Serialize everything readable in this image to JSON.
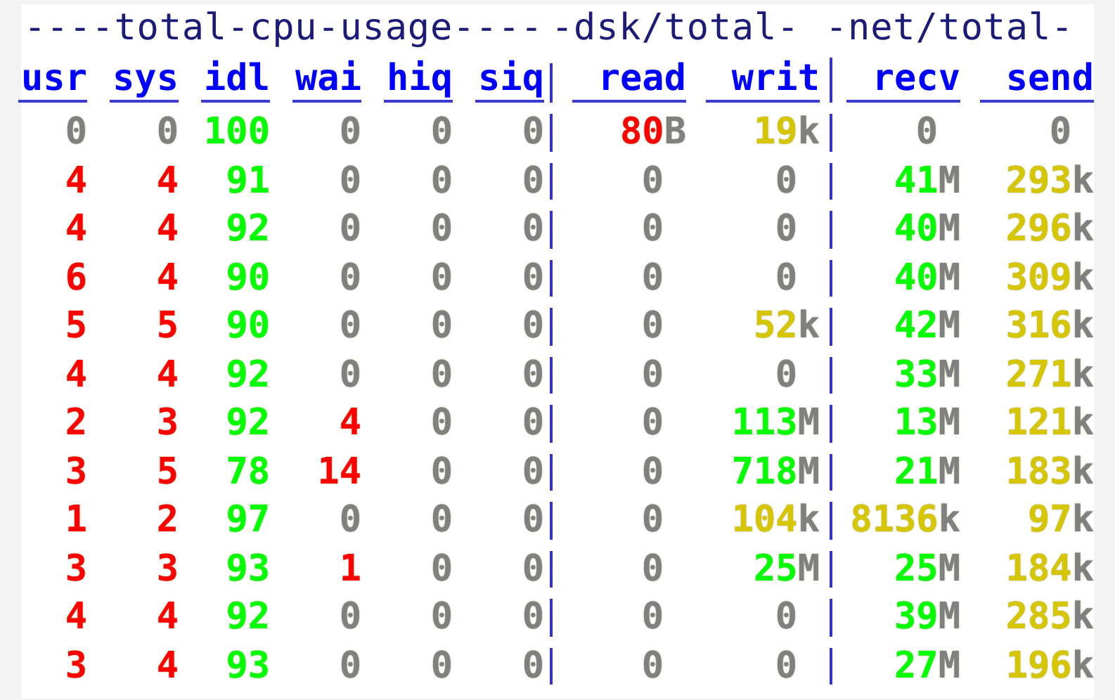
{
  "sections": [
    {
      "title": "----total-cpu-usage----",
      "kind": "cpu"
    },
    {
      "title": "-dsk/total-",
      "kind": "dsk"
    },
    {
      "title": "-net/total-",
      "kind": "net"
    }
  ],
  "columns": [
    {
      "label": "usr",
      "kind": "cpu"
    },
    {
      "label": "sys",
      "kind": "cpu"
    },
    {
      "label": "idl",
      "kind": "cpu"
    },
    {
      "label": "wai",
      "kind": "cpu"
    },
    {
      "label": "hiq",
      "kind": "cpu"
    },
    {
      "label": "siq",
      "kind": "cpu"
    },
    {
      "label": "read",
      "kind": "io"
    },
    {
      "label": "writ",
      "kind": "io"
    },
    {
      "label": "recv",
      "kind": "io"
    },
    {
      "label": "send",
      "kind": "io"
    }
  ],
  "rows": [
    {
      "cells": [
        {
          "value": "0",
          "color": "#808080"
        },
        {
          "value": "0",
          "color": "#808080"
        },
        {
          "value": "100",
          "color": "#00ff00"
        },
        {
          "value": "0",
          "color": "#808080"
        },
        {
          "value": "0",
          "color": "#808080"
        },
        {
          "value": "0",
          "color": "#808080"
        },
        {
          "value": "80",
          "unit": "B",
          "color": "#ff0000"
        },
        {
          "value": "19",
          "unit": "k",
          "color": "#d6c600"
        },
        {
          "value": "0",
          "color": "#808080"
        },
        {
          "value": "0",
          "color": "#808080"
        }
      ]
    },
    {
      "cells": [
        {
          "value": "4",
          "color": "#ff0000"
        },
        {
          "value": "4",
          "color": "#ff0000"
        },
        {
          "value": "91",
          "color": "#00ff00"
        },
        {
          "value": "0",
          "color": "#808080"
        },
        {
          "value": "0",
          "color": "#808080"
        },
        {
          "value": "0",
          "color": "#808080"
        },
        {
          "value": "0",
          "color": "#808080"
        },
        {
          "value": "0",
          "color": "#808080"
        },
        {
          "value": "41",
          "unit": "M",
          "color": "#00ff00"
        },
        {
          "value": "293",
          "unit": "k",
          "color": "#d6c600"
        }
      ]
    },
    {
      "cells": [
        {
          "value": "4",
          "color": "#ff0000"
        },
        {
          "value": "4",
          "color": "#ff0000"
        },
        {
          "value": "92",
          "color": "#00ff00"
        },
        {
          "value": "0",
          "color": "#808080"
        },
        {
          "value": "0",
          "color": "#808080"
        },
        {
          "value": "0",
          "color": "#808080"
        },
        {
          "value": "0",
          "color": "#808080"
        },
        {
          "value": "0",
          "color": "#808080"
        },
        {
          "value": "40",
          "unit": "M",
          "color": "#00ff00"
        },
        {
          "value": "296",
          "unit": "k",
          "color": "#d6c600"
        }
      ]
    },
    {
      "cells": [
        {
          "value": "6",
          "color": "#ff0000"
        },
        {
          "value": "4",
          "color": "#ff0000"
        },
        {
          "value": "90",
          "color": "#00ff00"
        },
        {
          "value": "0",
          "color": "#808080"
        },
        {
          "value": "0",
          "color": "#808080"
        },
        {
          "value": "0",
          "color": "#808080"
        },
        {
          "value": "0",
          "color": "#808080"
        },
        {
          "value": "0",
          "color": "#808080"
        },
        {
          "value": "40",
          "unit": "M",
          "color": "#00ff00"
        },
        {
          "value": "309",
          "unit": "k",
          "color": "#d6c600"
        }
      ]
    },
    {
      "cells": [
        {
          "value": "5",
          "color": "#ff0000"
        },
        {
          "value": "5",
          "color": "#ff0000"
        },
        {
          "value": "90",
          "color": "#00ff00"
        },
        {
          "value": "0",
          "color": "#808080"
        },
        {
          "value": "0",
          "color": "#808080"
        },
        {
          "value": "0",
          "color": "#808080"
        },
        {
          "value": "0",
          "color": "#808080"
        },
        {
          "value": "52",
          "unit": "k",
          "color": "#d6c600"
        },
        {
          "value": "42",
          "unit": "M",
          "color": "#00ff00"
        },
        {
          "value": "316",
          "unit": "k",
          "color": "#d6c600"
        }
      ]
    },
    {
      "cells": [
        {
          "value": "4",
          "color": "#ff0000"
        },
        {
          "value": "4",
          "color": "#ff0000"
        },
        {
          "value": "92",
          "color": "#00ff00"
        },
        {
          "value": "0",
          "color": "#808080"
        },
        {
          "value": "0",
          "color": "#808080"
        },
        {
          "value": "0",
          "color": "#808080"
        },
        {
          "value": "0",
          "color": "#808080"
        },
        {
          "value": "0",
          "color": "#808080"
        },
        {
          "value": "33",
          "unit": "M",
          "color": "#00ff00"
        },
        {
          "value": "271",
          "unit": "k",
          "color": "#d6c600"
        }
      ]
    },
    {
      "cells": [
        {
          "value": "2",
          "color": "#ff0000"
        },
        {
          "value": "3",
          "color": "#ff0000"
        },
        {
          "value": "92",
          "color": "#00ff00"
        },
        {
          "value": "4",
          "color": "#ff0000"
        },
        {
          "value": "0",
          "color": "#808080"
        },
        {
          "value": "0",
          "color": "#808080"
        },
        {
          "value": "0",
          "color": "#808080"
        },
        {
          "value": "113",
          "unit": "M",
          "color": "#00ff00"
        },
        {
          "value": "13",
          "unit": "M",
          "color": "#00ff00"
        },
        {
          "value": "121",
          "unit": "k",
          "color": "#d6c600"
        }
      ]
    },
    {
      "cells": [
        {
          "value": "3",
          "color": "#ff0000"
        },
        {
          "value": "5",
          "color": "#ff0000"
        },
        {
          "value": "78",
          "color": "#00ff00"
        },
        {
          "value": "14",
          "color": "#ff0000"
        },
        {
          "value": "0",
          "color": "#808080"
        },
        {
          "value": "0",
          "color": "#808080"
        },
        {
          "value": "0",
          "color": "#808080"
        },
        {
          "value": "718",
          "unit": "M",
          "color": "#00ff00"
        },
        {
          "value": "21",
          "unit": "M",
          "color": "#00ff00"
        },
        {
          "value": "183",
          "unit": "k",
          "color": "#d6c600"
        }
      ]
    },
    {
      "cells": [
        {
          "value": "1",
          "color": "#ff0000"
        },
        {
          "value": "2",
          "color": "#ff0000"
        },
        {
          "value": "97",
          "color": "#00ff00"
        },
        {
          "value": "0",
          "color": "#808080"
        },
        {
          "value": "0",
          "color": "#808080"
        },
        {
          "value": "0",
          "color": "#808080"
        },
        {
          "value": "0",
          "color": "#808080"
        },
        {
          "value": "104",
          "unit": "k",
          "color": "#d6c600"
        },
        {
          "value": "8136",
          "unit": "k",
          "color": "#d6c600"
        },
        {
          "value": "97",
          "unit": "k",
          "color": "#d6c600"
        }
      ]
    },
    {
      "cells": [
        {
          "value": "3",
          "color": "#ff0000"
        },
        {
          "value": "3",
          "color": "#ff0000"
        },
        {
          "value": "93",
          "color": "#00ff00"
        },
        {
          "value": "1",
          "color": "#ff0000"
        },
        {
          "value": "0",
          "color": "#808080"
        },
        {
          "value": "0",
          "color": "#808080"
        },
        {
          "value": "0",
          "color": "#808080"
        },
        {
          "value": "25",
          "unit": "M",
          "color": "#00ff00"
        },
        {
          "value": "25",
          "unit": "M",
          "color": "#00ff00"
        },
        {
          "value": "184",
          "unit": "k",
          "color": "#d6c600"
        }
      ]
    },
    {
      "cells": [
        {
          "value": "4",
          "color": "#ff0000"
        },
        {
          "value": "4",
          "color": "#ff0000"
        },
        {
          "value": "92",
          "color": "#00ff00"
        },
        {
          "value": "0",
          "color": "#808080"
        },
        {
          "value": "0",
          "color": "#808080"
        },
        {
          "value": "0",
          "color": "#808080"
        },
        {
          "value": "0",
          "color": "#808080"
        },
        {
          "value": "0",
          "color": "#808080"
        },
        {
          "value": "39",
          "unit": "M",
          "color": "#00ff00"
        },
        {
          "value": "285",
          "unit": "k",
          "color": "#d6c600"
        }
      ]
    },
    {
      "cells": [
        {
          "value": "3",
          "color": "#ff0000"
        },
        {
          "value": "4",
          "color": "#ff0000"
        },
        {
          "value": "93",
          "color": "#00ff00"
        },
        {
          "value": "0",
          "color": "#808080"
        },
        {
          "value": "0",
          "color": "#808080"
        },
        {
          "value": "0",
          "color": "#808080"
        },
        {
          "value": "0",
          "color": "#808080"
        },
        {
          "value": "0",
          "color": "#808080"
        },
        {
          "value": "27",
          "unit": "M",
          "color": "#00ff00"
        },
        {
          "value": "196",
          "unit": "k",
          "color": "#d6c600"
        }
      ]
    }
  ]
}
